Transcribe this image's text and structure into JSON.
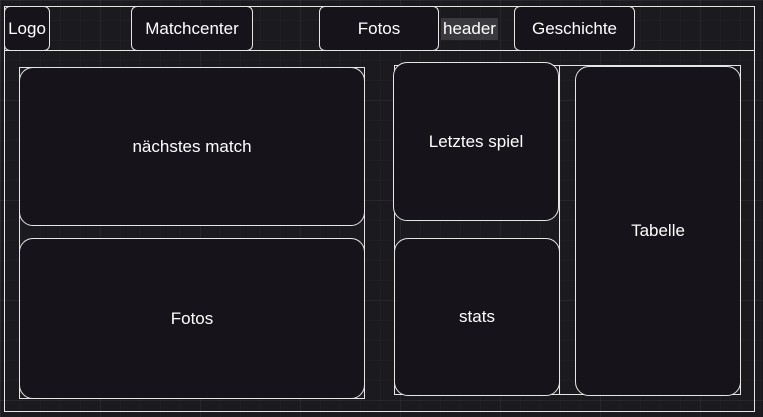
{
  "header": {
    "label": "header",
    "nav": {
      "logo": "Logo",
      "matchcenter": "Matchcenter",
      "fotos": "Fotos",
      "geschichte": "Geschichte"
    }
  },
  "main": {
    "next_match": "nächstes match",
    "photos": "Fotos",
    "last_game": "Letztes spiel",
    "stats": "stats",
    "table": "Tabelle"
  }
}
